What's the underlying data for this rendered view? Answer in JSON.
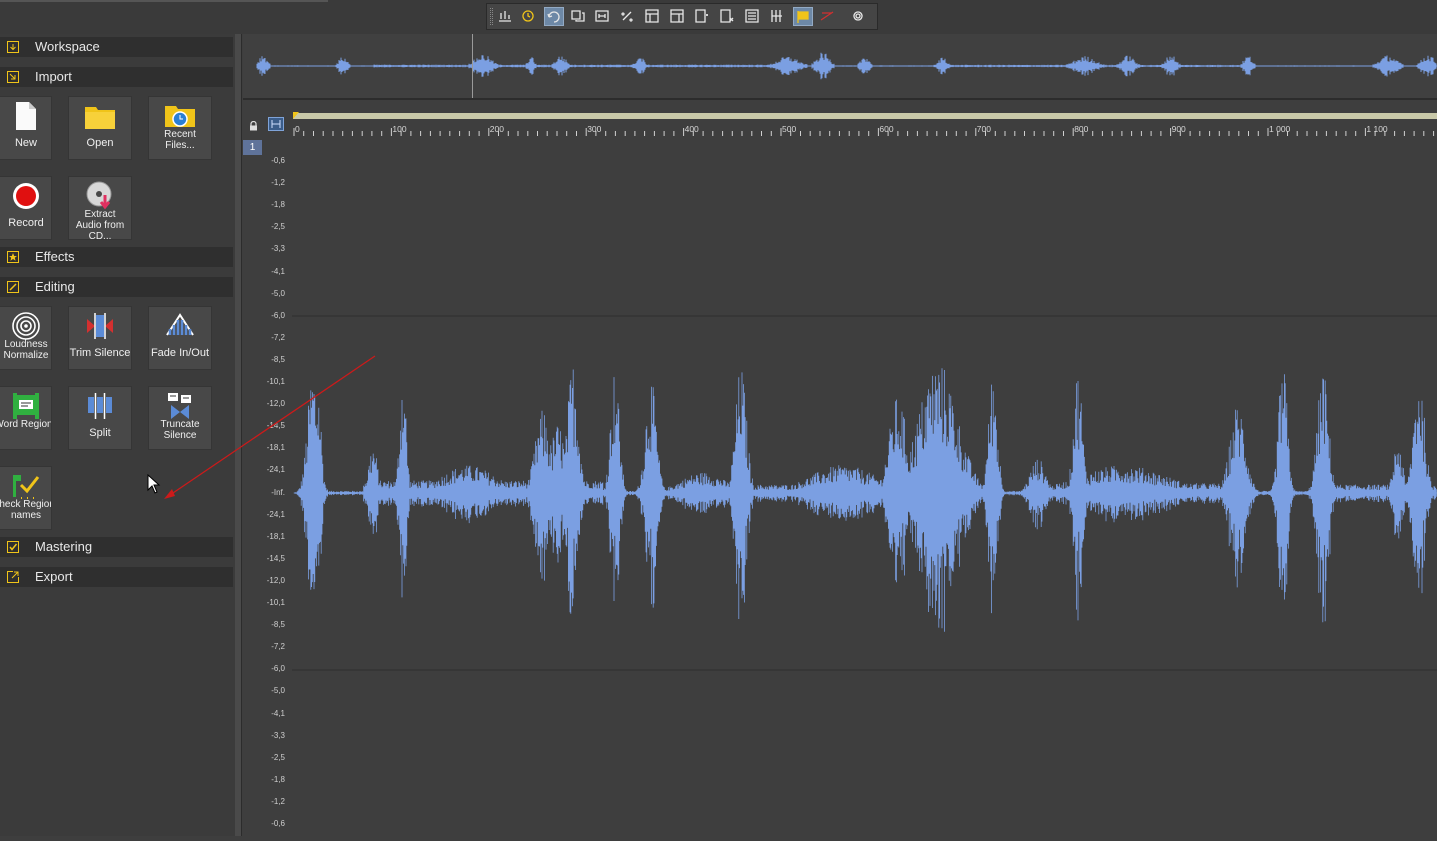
{
  "toolbar": {
    "buttons": [
      {
        "name": "auto-scroll-icon",
        "active": false
      },
      {
        "name": "stopwatch-icon",
        "active": false
      },
      {
        "name": "loop-icon",
        "active": true
      },
      {
        "name": "snap-to-marker-icon",
        "active": false
      },
      {
        "name": "region-view-icon",
        "active": false
      },
      {
        "name": "percent-icon",
        "active": false
      },
      {
        "name": "marker-table-icon",
        "active": false
      },
      {
        "name": "region-table-icon",
        "active": false
      },
      {
        "name": "add-marker-icon",
        "active": false
      },
      {
        "name": "add-region-icon",
        "active": false
      },
      {
        "name": "playlist-icon",
        "active": false
      },
      {
        "name": "split-regions-icon",
        "active": false
      },
      {
        "name": "comment-flag-icon",
        "active": true
      },
      {
        "name": "remove-marker-icon",
        "active": false
      },
      {
        "name": "settings-icon",
        "active": false
      }
    ]
  },
  "sidebar": {
    "sections": [
      {
        "label": "Workspace",
        "icon": "workspace-icon"
      },
      {
        "label": "Import",
        "icon": "import-icon"
      },
      {
        "label": "Effects",
        "icon": "effects-icon"
      },
      {
        "label": "Editing",
        "icon": "editing-icon"
      },
      {
        "label": "Mastering",
        "icon": "mastering-icon"
      },
      {
        "label": "Export",
        "icon": "export-icon"
      }
    ],
    "import_tiles": [
      {
        "label": "New",
        "icon": "new-file-icon"
      },
      {
        "label": "Open",
        "icon": "folder-icon"
      },
      {
        "label": "Recent Files...",
        "icon": "recent-files-icon"
      },
      {
        "label": "Record",
        "icon": "record-icon"
      },
      {
        "label": "Extract Audio from CD...",
        "icon": "cd-extract-icon"
      }
    ],
    "editing_tiles": [
      {
        "label": "Loudness Normalize",
        "icon": "loudness-icon"
      },
      {
        "label": "Trim Silence",
        "icon": "trim-silence-icon"
      },
      {
        "label": "Fade In/Out",
        "icon": "fade-icon"
      },
      {
        "label": "Word Regions",
        "icon": "word-regions-icon"
      },
      {
        "label": "Split",
        "icon": "split-icon"
      },
      {
        "label": "Truncate Silence",
        "icon": "truncate-silence-icon"
      },
      {
        "label": "Check Regions names",
        "icon": "check-regions-icon"
      }
    ]
  },
  "ruler": {
    "ticks": [
      "0",
      "100",
      "200",
      "300",
      "400",
      "500",
      "600",
      "700",
      "800",
      "900",
      "1 000",
      "1 100"
    ]
  },
  "channel": {
    "number": "1"
  },
  "amplitude_scale": {
    "labels": [
      "-0,6",
      "-1,2",
      "-1,8",
      "-2,5",
      "-3,3",
      "-4,1",
      "-5,0",
      "-6,0",
      "-7,2",
      "-8,5",
      "-10,1",
      "-12,0",
      "-14,5",
      "-18,1",
      "-24,1",
      "-Inf.",
      "-24,1",
      "-18,1",
      "-14,5",
      "-12,0",
      "-10,1",
      "-8,5",
      "-7,2",
      "-6,0",
      "-5,0",
      "-4,1",
      "-3,3",
      "-2,5",
      "-1,8",
      "-1,2",
      "-0,6"
    ]
  },
  "colors": {
    "waveform": "#7b9fe2",
    "background": "#3e3e3e",
    "section_header": "#2f2f2f",
    "tile": "#484848",
    "accent_yellow": "#f0c419",
    "ruler_bar": "#c8c8a8",
    "annotation_arrow": "#cc1a1a"
  }
}
